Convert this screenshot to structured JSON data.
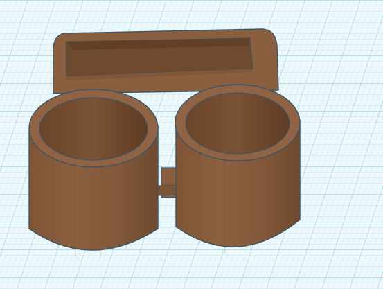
{
  "viewport": {
    "title": "",
    "colors": {
      "background": "#eef8fb",
      "grid_minor": "#bfe6ef",
      "grid_major": "#87cbdc",
      "model_outline": "#3a5566",
      "model_front": "#8a5f3f",
      "model_dark": "#6f4a2f",
      "model_inner": "#7d5536",
      "model_top": "#8f6343"
    }
  },
  "model": {
    "description_visible": "",
    "parts": [
      "tray",
      "left-cup",
      "right-cup",
      "connector-tab"
    ]
  }
}
